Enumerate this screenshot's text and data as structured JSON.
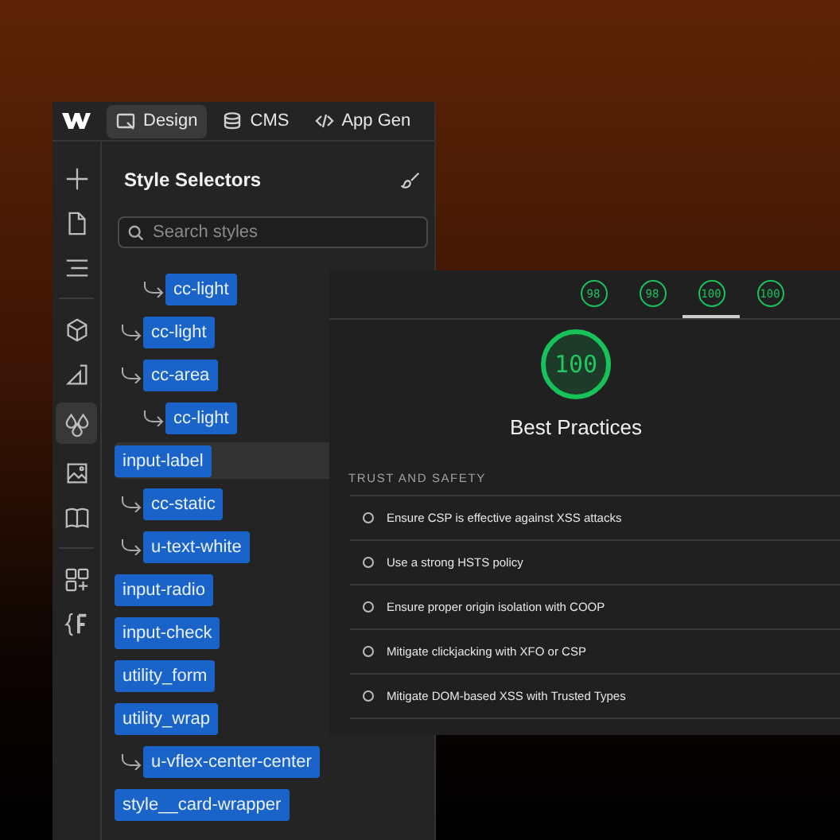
{
  "topbar": {
    "tabs": [
      {
        "label": "Design",
        "selected": true
      },
      {
        "label": "CMS",
        "selected": false
      },
      {
        "label": "App Gen",
        "selected": false
      }
    ]
  },
  "rail": [
    {
      "selected": false
    },
    {
      "selected": false
    },
    {
      "selected": false
    },
    {
      "selected": false
    },
    {
      "selected": false
    },
    {
      "selected": true
    },
    {
      "selected": false
    },
    {
      "selected": false
    },
    {
      "selected": false
    },
    {
      "selected": false
    }
  ],
  "panel": {
    "title": "Style Selectors",
    "search": {
      "placeholder": "Search styles"
    },
    "selectors": [
      {
        "children": [
          {
            "children": [
              {
                "label": "cc-light",
                "selected": false
              }
            ]
          },
          {
            "label": "cc-light",
            "selected": false
          },
          {
            "label": "cc-area",
            "selected": false,
            "children": [
              {
                "label": "cc-light",
                "selected": false
              }
            ]
          }
        ]
      },
      {
        "label": "input-label",
        "selected": true,
        "children": [
          {
            "label": "cc-static",
            "selected": false
          },
          {
            "label": "u-text-white",
            "selected": false
          }
        ]
      },
      {
        "label": "input-radio",
        "selected": false
      },
      {
        "label": "input-check",
        "selected": false
      },
      {
        "label": "utility_form",
        "selected": false
      },
      {
        "label": "utility_wrap",
        "selected": false,
        "children": [
          {
            "label": "u-vflex-center-center",
            "selected": false
          }
        ]
      },
      {
        "label": "style__card-wrapper",
        "selected": false
      }
    ]
  },
  "report": {
    "scores": [
      {
        "value": "98",
        "selected": false
      },
      {
        "value": "98",
        "selected": false
      },
      {
        "value": "100",
        "selected": true
      },
      {
        "value": "100",
        "selected": false
      }
    ],
    "gauge": {
      "value": "100",
      "title": "Best Practices"
    },
    "section": "TRUST AND SAFETY",
    "audits": [
      "Ensure CSP is effective against XSS attacks",
      "Use a strong HSTS policy",
      "Ensure proper origin isolation with COOP",
      "Mitigate clickjacking with XFO or CSP",
      "Mitigate DOM-based XSS with Trusted Types"
    ]
  }
}
